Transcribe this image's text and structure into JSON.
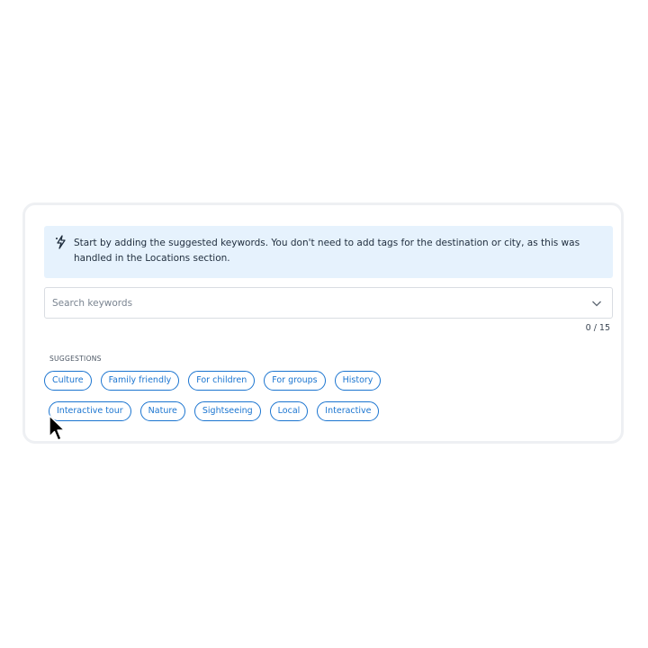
{
  "banner": {
    "icon": "sparkle-icon",
    "text": "Start by adding the suggested keywords. You don't need to add tags for the destination or city, as this was handled in the Locations section."
  },
  "search": {
    "placeholder": "Search keywords",
    "value": "",
    "dropdown_icon": "chevron-down-icon"
  },
  "counter": "0 / 15",
  "suggestions": {
    "label": "SUGGESTIONS",
    "row1": [
      "Culture",
      "Family friendly",
      "For children",
      "For groups",
      "History"
    ],
    "row2": [
      "Interactive tour",
      "Nature",
      "Sightseeing",
      "Local",
      "Interactive"
    ]
  },
  "colors": {
    "accent": "#1b75d0",
    "banner_bg": "#e6f2fd"
  }
}
